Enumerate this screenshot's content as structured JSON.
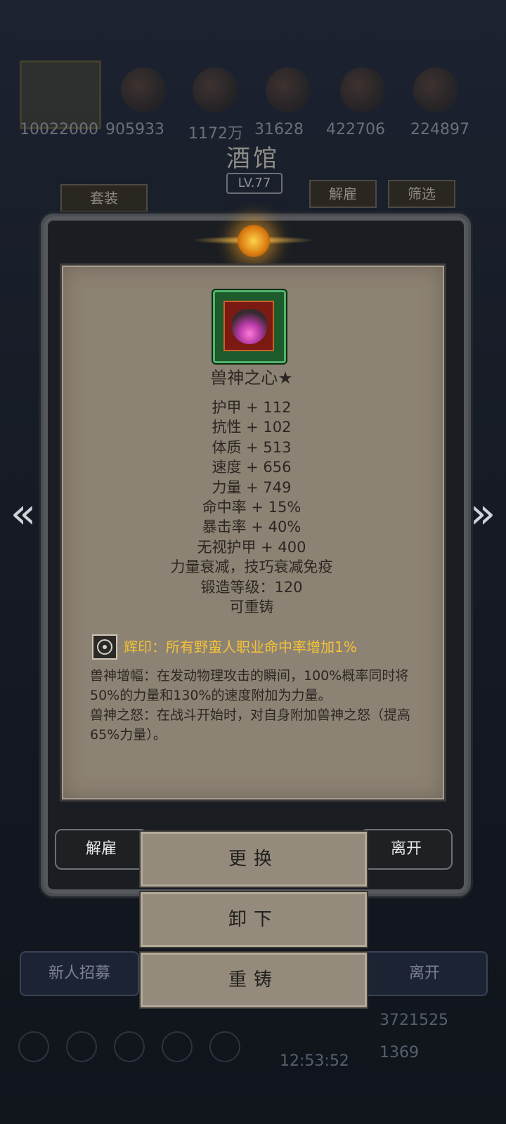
{
  "background": {
    "hero_id": "10022000",
    "resources": [
      "905933",
      "1172万",
      "31628",
      "422706",
      "224897"
    ],
    "title": "酒馆",
    "level": "LV.77",
    "suit_button": "套装",
    "dismiss_button": "解雇",
    "filter_button": "筛选",
    "recruit_button": "新人招募",
    "leave_button": "离开",
    "gold": "3721525",
    "gems": "1369",
    "time": "12:53:52"
  },
  "item": {
    "name": "兽神之心★",
    "stats": [
      "护甲 + 112",
      "抗性 + 102",
      "体质 + 513",
      "速度 + 656",
      "力量 + 749",
      "命中率 + 15%",
      "暴击率 + 40%",
      "无视护甲 + 400",
      "力量衰减，技巧衰减免疫",
      "锻造等级：120",
      "可重铸"
    ],
    "imprint": "辉印：所有野蛮人职业命中率增加1%",
    "skill_1": "兽神增幅：在发动物理攻击的瞬间，100%概率同时将50%的力量和130%的速度附加为力量。",
    "skill_2": "兽神之怒：在战斗开始时，对自身附加兽神之怒（提高65%力量）。"
  },
  "actions": {
    "dismiss": "解雇",
    "leave": "离开",
    "replace": "更换",
    "unequip": "卸下",
    "reforge": "重铸"
  },
  "colors": {
    "parchment": "#8d8374",
    "imprint_text": "#f5c236",
    "frame": "#1a1d22"
  }
}
